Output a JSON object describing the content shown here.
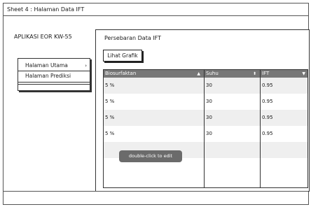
{
  "window": {
    "title": "Sheet 4 : Halaman Data IFT"
  },
  "app": {
    "title": "APLIKASI EOR KW-55"
  },
  "nav": {
    "items": [
      {
        "label": "Halaman Utama",
        "chevron": "›"
      },
      {
        "label": "Halaman Prediksi"
      }
    ]
  },
  "panel": {
    "title": "Persebaran Data IFT",
    "button_label": "Lihat Grafik"
  },
  "table": {
    "columns": [
      {
        "label": "Biosurfaktan",
        "sort_icon": "▲"
      },
      {
        "label": "Suhu",
        "sort_icon": "⬍"
      },
      {
        "label": "IFT",
        "sort_icon": "▼"
      }
    ],
    "rows": [
      [
        "5 %",
        "30",
        "0.95"
      ],
      [
        "5 %",
        "30",
        "0.95"
      ],
      [
        "5 %",
        "30",
        "0.95"
      ],
      [
        "5 %",
        "30",
        "0.95"
      ],
      [
        "",
        "",
        ""
      ],
      [
        "",
        "",
        ""
      ]
    ]
  },
  "tooltip": {
    "text": "double-click to edit"
  }
}
